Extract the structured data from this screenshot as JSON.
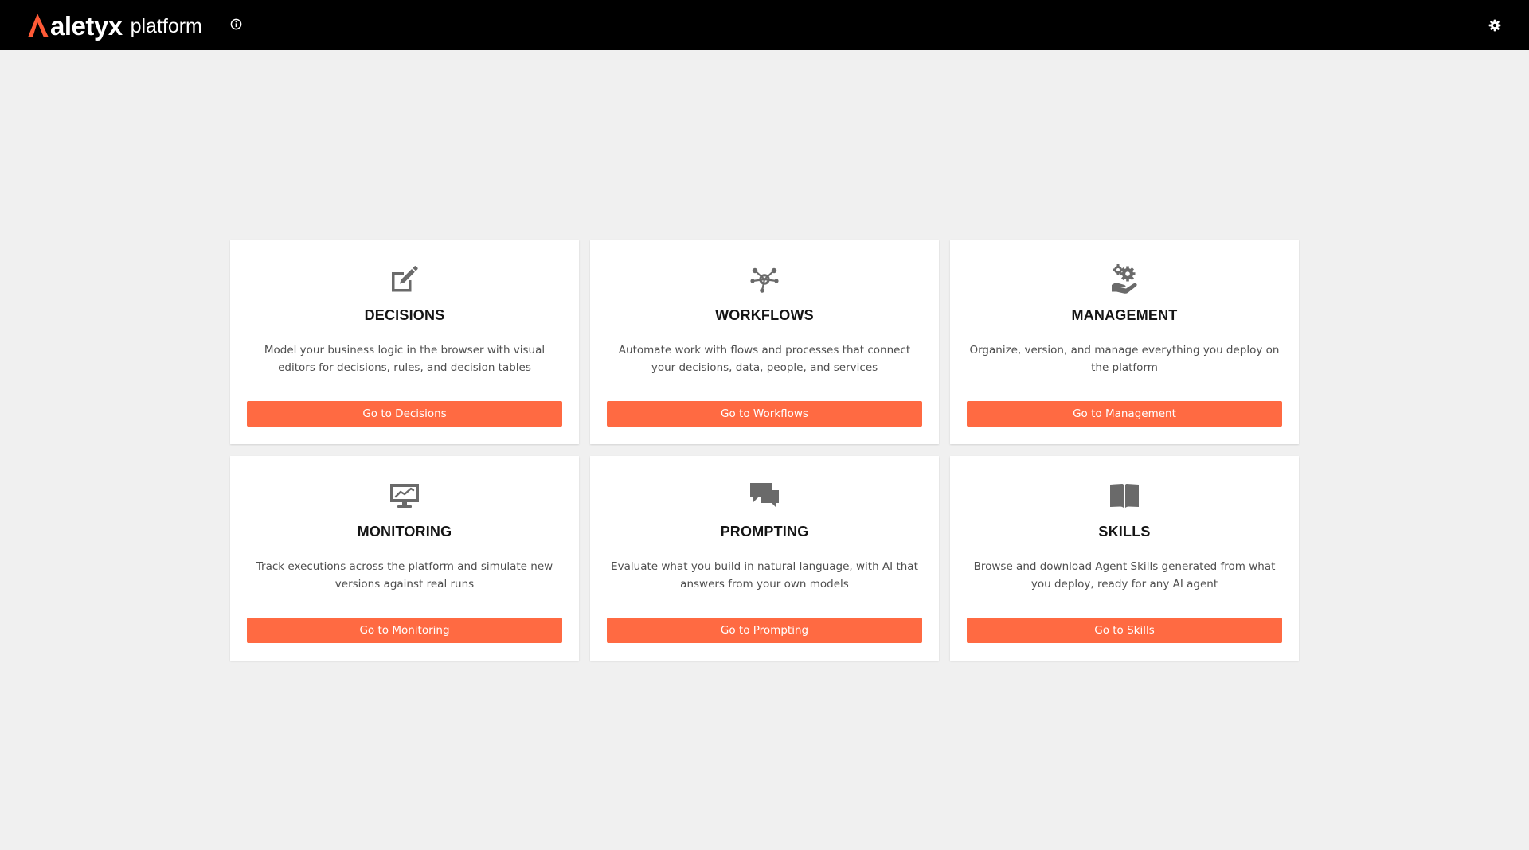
{
  "header": {
    "brand_word": "aletyx",
    "product_name": "platform",
    "brand_accent": "#ff5a36",
    "info_icon": "info-circle-icon",
    "settings_icon": "gear-icon"
  },
  "colors": {
    "masthead": "#000000",
    "background": "#f0f0f0",
    "button": "#ff6a42",
    "icon": "#6a6a6a"
  },
  "cards": [
    {
      "icon": "pencil-square-icon",
      "title": "DECISIONS",
      "description": "Model your business logic in the browser with visual editors for decisions, rules, and decision tables",
      "button_label": "Go to Decisions"
    },
    {
      "icon": "network-hub-icon",
      "title": "WORKFLOWS",
      "description": "Automate work with flows and processes that connect your decisions, data, people, and services",
      "button_label": "Go to Workflows"
    },
    {
      "icon": "gears-hand-icon",
      "title": "MANAGEMENT",
      "description": "Organize, version, and manage everything you deploy on the platform",
      "button_label": "Go to Management"
    },
    {
      "icon": "monitor-chart-icon",
      "title": "MONITORING",
      "description": "Track executions across the platform and simulate new versions against real runs",
      "button_label": "Go to Monitoring"
    },
    {
      "icon": "chat-bubbles-icon",
      "title": "PROMPTING",
      "description": "Evaluate what you build in natural language, with AI that answers from your own models",
      "button_label": "Go to Prompting"
    },
    {
      "icon": "open-book-icon",
      "title": "SKILLS",
      "description": "Browse and download Agent Skills generated from what you deploy, ready for any AI agent",
      "button_label": "Go to Skills"
    }
  ]
}
